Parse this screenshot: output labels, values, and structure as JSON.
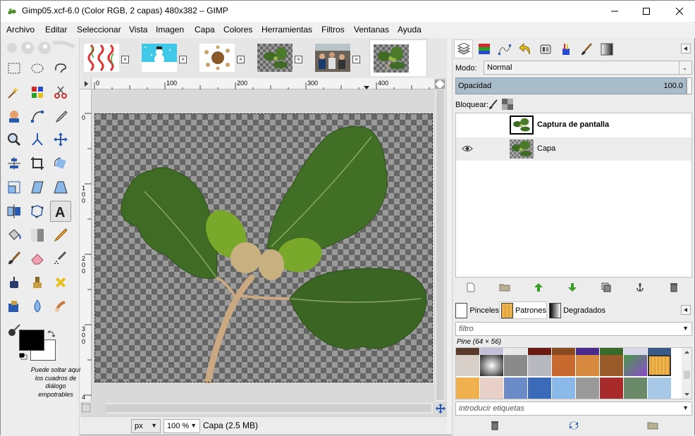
{
  "window": {
    "title": "Gimp05.xcf-6.0 (Color RGB, 2 capas) 480x382 – GIMP",
    "minimize_glyph": "—",
    "maximize_glyph": "☐",
    "close_glyph": "✕"
  },
  "menu": [
    "Archivo",
    "Editar",
    "Seleccionar",
    "Vista",
    "Imagen",
    "Capa",
    "Colores",
    "Herramientas",
    "Filtros",
    "Ventanas",
    "Ayuda"
  ],
  "toolbox": {
    "drop_hint": "Puede soltar aquí los cuadros de diálogo empotrables",
    "foreground_color": "#000000",
    "background_color": "#ffffff",
    "tools": [
      "rect-select-icon",
      "ellipse-select-icon",
      "free-select-icon",
      "fuzzy-select-icon",
      "color-select-icon",
      "scissors-icon",
      "foreground-select-icon",
      "paths-icon",
      "color-picker-icon",
      "zoom-icon",
      "measure-icon",
      "move-icon",
      "align-icon",
      "crop-icon",
      "rotate-icon",
      "scale-icon",
      "shear-icon",
      "perspective-icon",
      "flip-icon",
      "cage-icon",
      "text-icon",
      "bucket-fill-icon",
      "blend-icon",
      "pencil-icon",
      "paintbrush-icon",
      "eraser-icon",
      "airbrush-icon",
      "ink-icon",
      "clone-icon",
      "heal-icon",
      "perspective-clone-icon",
      "blur-icon",
      "smudge-icon",
      "dodge-burn-icon"
    ]
  },
  "image_tabs": [
    {
      "name": "tab-image-1",
      "close": "×"
    },
    {
      "name": "tab-image-2",
      "close": "×"
    },
    {
      "name": "tab-image-3",
      "close": "×"
    },
    {
      "name": "tab-image-4",
      "close": "×"
    },
    {
      "name": "tab-image-5",
      "close": "×"
    },
    {
      "name": "tab-image-6",
      "close": ""
    }
  ],
  "rulers": {
    "h_labels": [
      "0",
      "100",
      "200",
      "300",
      "400"
    ],
    "v_labels": [
      "0",
      "1\n0\n0",
      "2\n0\n0",
      "3\n0\n0",
      "4"
    ]
  },
  "status": {
    "unit": "px",
    "zoom": "100 %",
    "text": "Capa (2.5 MB)"
  },
  "layers_dock": {
    "mode_label": "Modo:",
    "mode_value": "Normal",
    "opacity_label": "Opacidad",
    "opacity_value": "100.0",
    "lock_label": "Bloquear:",
    "layers": [
      {
        "name": "Captura de pantalla",
        "bold": true,
        "visible": false
      },
      {
        "name": "Capa",
        "bold": false,
        "visible": true
      }
    ]
  },
  "patterns_dock": {
    "tabs": [
      "Pinceles",
      "Patrones",
      "Degradados"
    ],
    "filter_placeholder": "filtro",
    "pattern_name": "Pine (64 × 56)",
    "tags_placeholder": "introducir etiquetas"
  },
  "colors": {
    "accent_opacity": "#a9bcca",
    "selection_border": "#e8e040"
  }
}
